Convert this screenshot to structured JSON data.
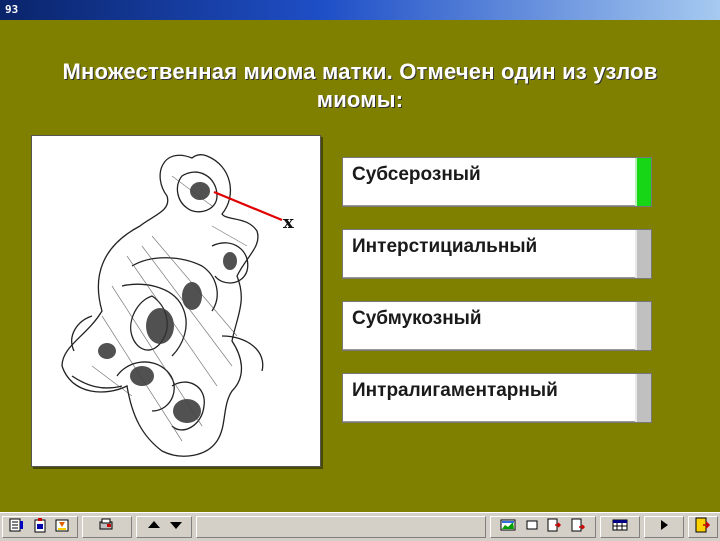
{
  "window": {
    "title": "93"
  },
  "slide": {
    "title": "Множественная миома матки. Отмечен один из узлов миомы:"
  },
  "figure": {
    "marker": "x"
  },
  "options": [
    {
      "label": "Субсерозный",
      "selected": true
    },
    {
      "label": "Интерстициальный",
      "selected": false
    },
    {
      "label": "Субмукозный",
      "selected": false
    },
    {
      "label": "Интралигаментарный",
      "selected": false
    }
  ],
  "colors": {
    "background": "#808000",
    "selected_indicator": "#16d616",
    "unselected_indicator": "#c0c0c0"
  },
  "toolbar": {
    "icons": [
      "notes-icon",
      "clipboard-icon",
      "download-icon",
      "print-icon",
      "up-arrow-icon",
      "down-arrow-icon",
      "chart-icon",
      "window-icon",
      "export-icon",
      "export-alt-icon",
      "table-icon",
      "play-icon",
      "exit-icon"
    ]
  }
}
